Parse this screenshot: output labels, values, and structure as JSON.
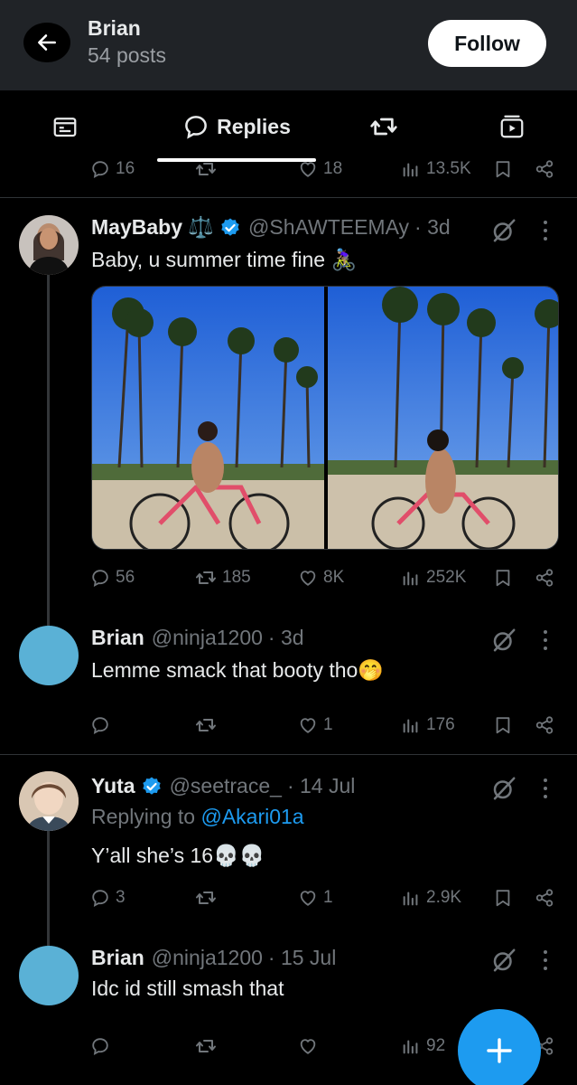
{
  "header": {
    "title": "Brian",
    "subtitle": "54 posts",
    "follow_label": "Follow"
  },
  "tabs": {
    "active_label": "Replies"
  },
  "top_actions": {
    "replies": "16",
    "likes": "18",
    "views": "13.5K"
  },
  "tweets": [
    {
      "name": "MayBaby ⚖️",
      "handle": "@ShAWTEEMAy",
      "time": "· 3d",
      "verified": true,
      "text": "Baby, u summer time fine 🚴🏽‍♀️",
      "replies": "56",
      "retweets": "185",
      "likes": "8K",
      "views": "252K"
    },
    {
      "name": "Brian",
      "handle": "@ninja1200",
      "time": "· 3d",
      "text": "Lemme smack that booty tho🤭",
      "replies": "",
      "retweets": "",
      "likes": "1",
      "views": "176"
    },
    {
      "name": "Yuta",
      "handle": "@seetrace_",
      "time": "· 14 Jul",
      "verified": true,
      "replying_prefix": "Replying to ",
      "replying_to": "@Akari01a",
      "text": "Y’all she’s 16💀💀",
      "replies": "3",
      "retweets": "",
      "likes": "1",
      "views": "2.9K"
    },
    {
      "name": "Brian",
      "handle": "@ninja1200",
      "time": "· 15 Jul",
      "text": "Idc id still smash that",
      "replies": "",
      "retweets": "",
      "likes": "",
      "views": "92"
    }
  ],
  "colors": {
    "accent": "#1d9bf0",
    "header_bg": "#202327",
    "muted": "#71767b",
    "default_avatar": "#5ab1d6"
  },
  "icons": [
    "back-arrow-icon",
    "reply-icon",
    "retweet-icon",
    "like-icon",
    "views-icon",
    "bookmark-icon",
    "share-icon",
    "grok-icon",
    "more-icon",
    "compose-plus-icon",
    "verified-badge-icon"
  ]
}
